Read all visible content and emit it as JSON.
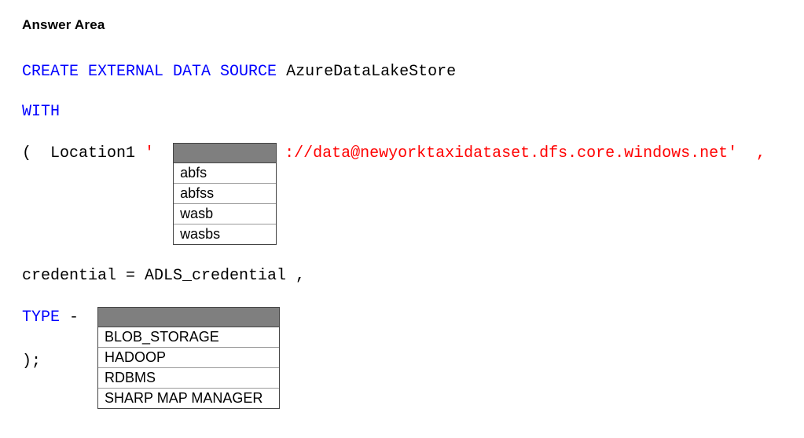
{
  "title": "Answer Area",
  "sql": {
    "createKw": "CREATE EXTERNAL DATA SOURCE",
    "dataSourceName": " AzureDataLakeStore",
    "withKw": "WITH",
    "openParen": "(  ",
    "locationLabel": "Location1 ",
    "quote1": "'  ",
    "urlSuffix": "://data@newyorktaxidataset.dfs.core.windows.net'  ,",
    "credentialLine": "credential = ADLS_credential ,",
    "typeKw": "TYPE ",
    "dash": "-  ",
    "closeLine": ");"
  },
  "dropdown1": {
    "options": [
      "abfs",
      "abfss",
      "wasb",
      "wasbs"
    ]
  },
  "dropdown2": {
    "options": [
      "BLOB_STORAGE",
      "HADOOP",
      "RDBMS",
      "SHARP MAP MANAGER"
    ]
  }
}
